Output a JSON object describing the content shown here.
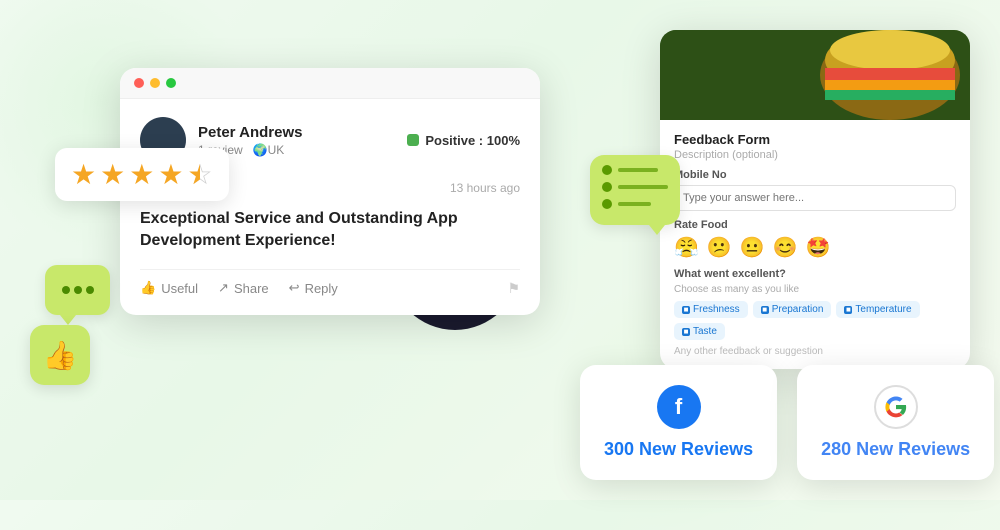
{
  "background": {
    "color_start": "#f0faf0",
    "color_end": "#e8f8e8"
  },
  "stars_badge": {
    "filled_stars": 4,
    "half_star": true,
    "aria": "4.5 star rating"
  },
  "chat_bubble": {
    "dots": 3
  },
  "thumbs_badge": {
    "icon": "👍"
  },
  "browser_window": {
    "dots": [
      "red",
      "yellow",
      "green"
    ]
  },
  "review_card": {
    "reviewer_name": "Peter Andrews",
    "reviewer_reviews": "1 review",
    "reviewer_location": "🌍UK",
    "positive_label": "Positive : 100%",
    "stars": 5,
    "time_ago": "13 hours ago",
    "title": "Exceptional Service and Outstanding App Development Experience!",
    "actions": {
      "useful": "Useful",
      "share": "Share",
      "reply": "Reply"
    }
  },
  "feedback_form": {
    "title": "Feedback Form",
    "description_label": "Description (optional)",
    "mobile_label": "Mobile No",
    "mobile_placeholder": "Type your answer here...",
    "rate_label": "Rate Food",
    "emojis": [
      "😤",
      "😕",
      "😐",
      "😊",
      "🤩"
    ],
    "excellent_label": "What went excellent?",
    "choose_hint": "Choose as many as you like",
    "chips": [
      "Freshness",
      "Preparation",
      "Temperature",
      "Taste"
    ],
    "feedback_placeholder": "Any other feedback or suggestion"
  },
  "list_card": {
    "lines": 3,
    "bar_widths": [
      "60%",
      "80%",
      "50%"
    ]
  },
  "review_counts": [
    {
      "platform": "Facebook",
      "logo_letter": "f",
      "count_text": "300 New Reviews",
      "color": "#1877f2",
      "logo_type": "fb"
    },
    {
      "platform": "Google",
      "logo_letter": "G",
      "count_text": "280 New Reviews",
      "color": "#4285f4",
      "logo_type": "google"
    }
  ]
}
